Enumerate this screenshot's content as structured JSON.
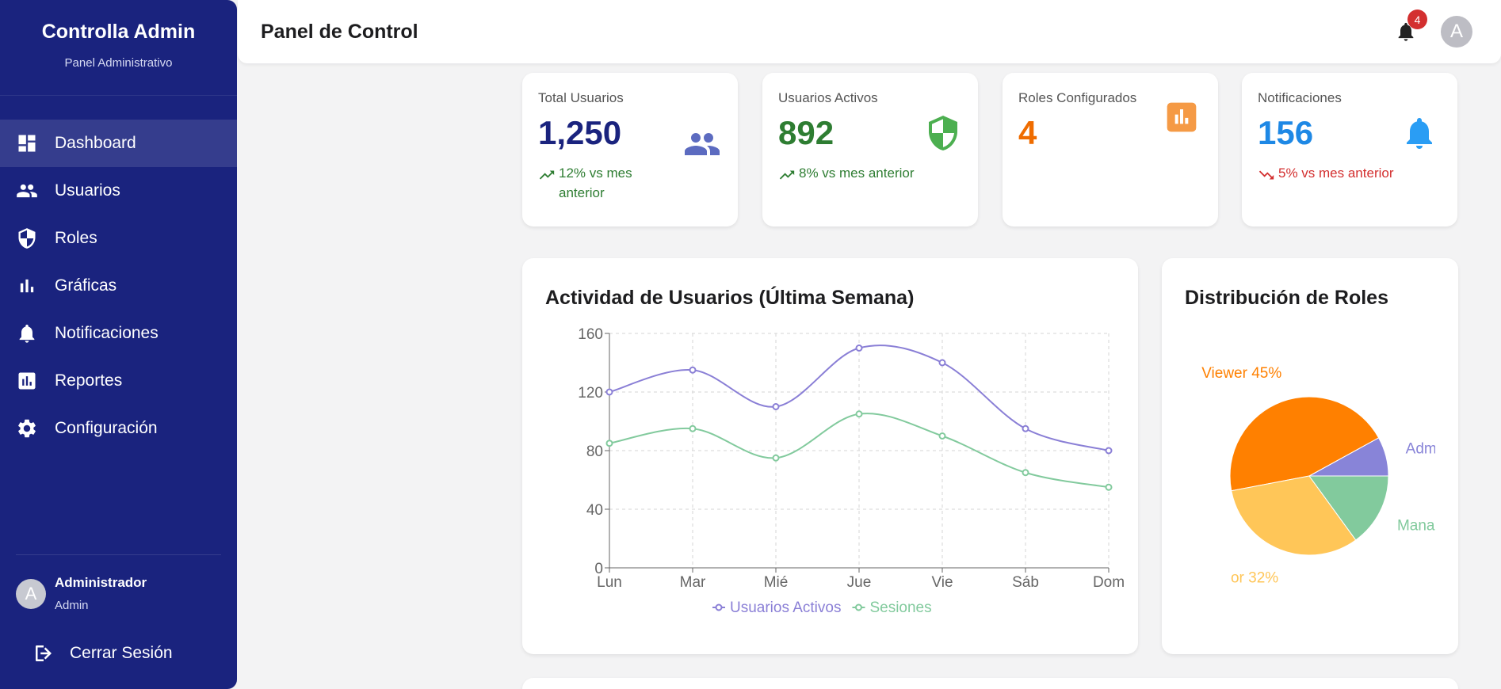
{
  "sidebar": {
    "brand_title": "Controlla Admin",
    "brand_subtitle": "Panel Administrativo",
    "items": [
      {
        "label": "Dashboard",
        "icon": "dashboard-icon",
        "active": true
      },
      {
        "label": "Usuarios",
        "icon": "people-icon"
      },
      {
        "label": "Roles",
        "icon": "shield-icon"
      },
      {
        "label": "Gráficas",
        "icon": "bar-chart-icon"
      },
      {
        "label": "Notificaciones",
        "icon": "bell-icon"
      },
      {
        "label": "Reportes",
        "icon": "report-icon"
      },
      {
        "label": "Configuración",
        "icon": "gear-icon"
      }
    ],
    "user": {
      "avatar": "A",
      "name": "Administrador",
      "role": "Admin"
    },
    "logout_label": "Cerrar Sesión"
  },
  "header": {
    "title": "Panel de Control",
    "notification_count": "4",
    "avatar": "A"
  },
  "stats": [
    {
      "label": "Total Usuarios",
      "value": "1,250",
      "trend": "12% vs mes anterior",
      "trend_dir": "up",
      "color": "#1a237e",
      "icon": "people-icon",
      "icon_color": "#5c6bc0"
    },
    {
      "label": "Usuarios Activos",
      "value": "892",
      "trend": "8% vs mes anterior",
      "trend_dir": "up",
      "color": "#2e7d32",
      "icon": "shield-icon",
      "icon_color": "#4caf50"
    },
    {
      "label": "Roles Configurados",
      "value": "4",
      "trend": "",
      "color": "#ef6c00",
      "icon": "bar-chart-icon",
      "icon_color": "#f59a45"
    },
    {
      "label": "Notificaciones",
      "value": "156",
      "trend": "5% vs mes anterior",
      "trend_dir": "down",
      "color": "#1e88e5",
      "icon": "bell-icon",
      "icon_color": "#2a9df4"
    }
  ],
  "trend_colors": {
    "up": "#2e7d32",
    "down": "#d32f2f"
  },
  "chart_data": [
    {
      "type": "line",
      "title": "Actividad de Usuarios (Última Semana)",
      "categories": [
        "Lun",
        "Mar",
        "Mié",
        "Jue",
        "Vie",
        "Sáb",
        "Dom"
      ],
      "series": [
        {
          "name": "Usuarios Activos",
          "values": [
            120,
            135,
            110,
            150,
            140,
            95,
            80
          ],
          "color": "#8a7fd6"
        },
        {
          "name": "Sesiones",
          "values": [
            85,
            95,
            75,
            105,
            90,
            65,
            55
          ],
          "color": "#82ca9d"
        }
      ],
      "ylim": [
        0,
        160
      ],
      "yticks": [
        0,
        40,
        80,
        120,
        160
      ],
      "grid": true,
      "legend": "bottom"
    },
    {
      "type": "pie",
      "title": "Distribución de Roles",
      "slices": [
        {
          "name": "Admin",
          "value": 8,
          "color": "#8884d8",
          "label": "Adm"
        },
        {
          "name": "Viewer",
          "value": 45,
          "color": "#ff8000",
          "label": "Viewer 45%"
        },
        {
          "name": "Editor",
          "value": 32,
          "color": "#ffc658",
          "label": "or 32%"
        },
        {
          "name": "Manager",
          "value": 15,
          "color": "#82ca9d",
          "label": "Manager"
        }
      ]
    }
  ]
}
